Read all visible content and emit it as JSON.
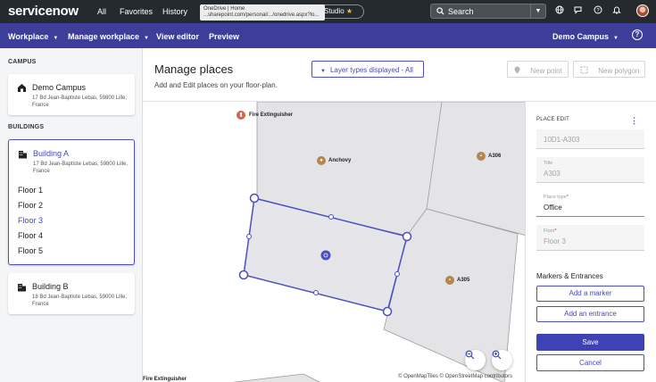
{
  "topbar": {
    "logo_text": "servicenow",
    "logo_dot": "",
    "nav": [
      "All",
      "Favorites",
      "History"
    ],
    "tooltip_line1": "OneDrive | Home",
    "tooltip_line2": "...sharepoint.com/personal/.../onedrive.aspx?lo...",
    "studio_label": "Studio",
    "search_label": "Search",
    "icons": [
      "globe-icon",
      "chat-icon",
      "help-circle-icon",
      "bell-icon"
    ],
    "avatar": "user-avatar"
  },
  "navbar": {
    "workplace": "Workplace",
    "manage_workplace": "Manage workplace",
    "view_editor": "View editor",
    "preview": "Preview",
    "campus_selector": "Demo Campus",
    "help": "?"
  },
  "sidebar": {
    "campus_heading": "CAMPUS",
    "campus": {
      "name": "Demo Campus",
      "address": "17 Bd Jean-Baptiste Lebas, 59800 Lille, France"
    },
    "buildings_heading": "BUILDINGS",
    "building_a": {
      "name": "Building A",
      "address": "17 Bd Jean-Baptiste Lebas, 59800 Lille, France",
      "floors": [
        "Floor 1",
        "Floor 2",
        "Floor 3",
        "Floor 4",
        "Floor 5"
      ],
      "selected_floor": "Floor 3"
    },
    "building_b": {
      "name": "Building B",
      "address": "18 Bd Jean-Baptiste Lebas, 59000 Lille, France"
    }
  },
  "main": {
    "title": "Manage places",
    "subtitle": "Add and Edit places on your floor-plan.",
    "layer_button": "Layer types displayed - All",
    "new_point": "New point",
    "new_polygon": "New polygon"
  },
  "map": {
    "labels": {
      "fire_top": "Fire Extinguisher",
      "anchovy": "Anchovy",
      "a306": "A306",
      "a305": "A305",
      "fire_bottom": "Fire Extinguisher"
    },
    "attribution": "© OpenMapTiles © OpenStreetMap contributors",
    "colors": {
      "room_fill": "#e4e4e6",
      "room_stroke": "#9c9c9f",
      "edit_stroke": "#4b4fbf",
      "pin_brown": "#b58552",
      "pin_red": "#d4634a"
    }
  },
  "panel": {
    "heading": "PLACE EDIT",
    "code_value": "10D1-A303",
    "title_label": "Title",
    "title_value": "A303",
    "place_type_label": "Place type",
    "place_type_value": "Office",
    "floor_label": "Floor",
    "floor_value": "Floor 3",
    "markers_heading": "Markers & Entrances",
    "add_marker": "Add a marker",
    "add_entrance": "Add an entrance",
    "save": "Save",
    "cancel": "Cancel"
  }
}
